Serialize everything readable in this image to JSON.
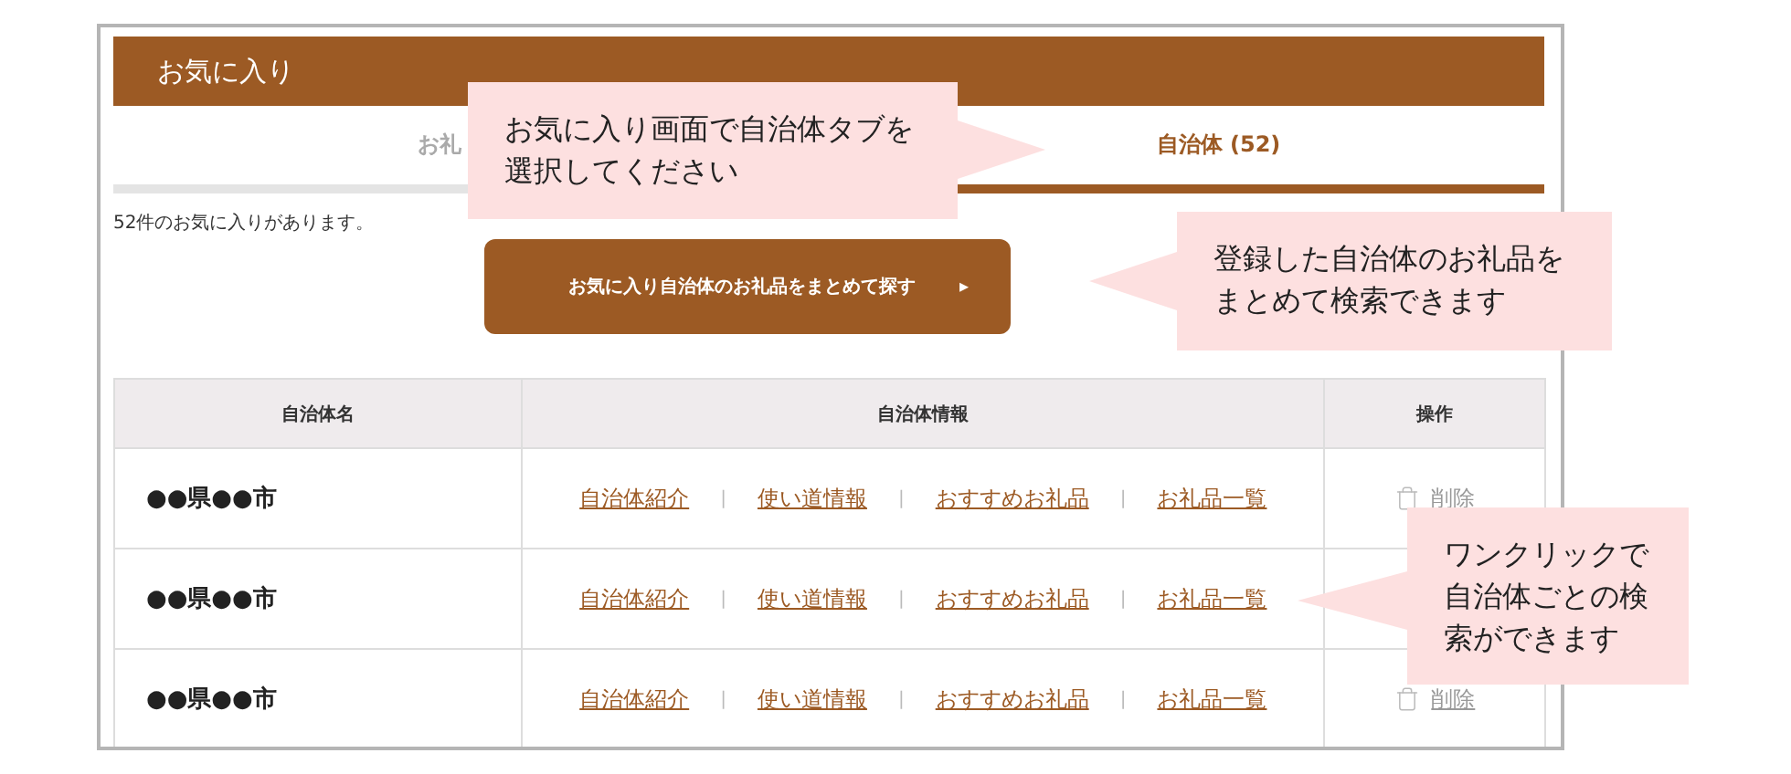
{
  "header": {
    "title": "お気に入り"
  },
  "tabs": [
    {
      "label": "お礼",
      "selected": false
    },
    {
      "label": "自治体 (52)",
      "selected": true
    }
  ],
  "count_text": "52件のお気に入りがあります。",
  "search_button": {
    "label": "お気に入り自治体のお礼品をまとめて探す",
    "arrow": "▸"
  },
  "table": {
    "columns": [
      "自治体名",
      "自治体情報",
      "操作"
    ],
    "rows": [
      {
        "name": "●●県●●市",
        "links": [
          {
            "kind": "link",
            "text": "自治体紹介"
          },
          {
            "kind": "separator",
            "text": "|"
          },
          {
            "kind": "link",
            "text": "使い道情報"
          },
          {
            "kind": "separator",
            "text": "|"
          },
          {
            "kind": "link",
            "text": "おすすめお礼品"
          },
          {
            "kind": "separator",
            "text": "|"
          },
          {
            "kind": "link",
            "text": "お礼品一覧"
          }
        ],
        "delete": "削除"
      },
      {
        "name": "●●県●●市",
        "links": [
          {
            "kind": "link",
            "text": "自治体紹介"
          },
          {
            "kind": "separator",
            "text": "|"
          },
          {
            "kind": "link",
            "text": "使い道情報"
          },
          {
            "kind": "separator",
            "text": "|"
          },
          {
            "kind": "link",
            "text": "おすすめお礼品"
          },
          {
            "kind": "separator",
            "text": "|"
          },
          {
            "kind": "link",
            "text": "お礼品一覧"
          }
        ]
      },
      {
        "name": "●●県●●市",
        "links": [
          {
            "kind": "link",
            "text": "自治体紹介"
          },
          {
            "kind": "separator",
            "text": "|"
          },
          {
            "kind": "link",
            "text": "使い道情報"
          },
          {
            "kind": "separator",
            "text": "|"
          },
          {
            "kind": "link",
            "text": "おすすめお礼品"
          },
          {
            "kind": "separator",
            "text": "|"
          },
          {
            "kind": "link",
            "text": "お礼品一覧"
          }
        ],
        "delete": "削除"
      }
    ]
  },
  "callouts": [
    {
      "text": "お気に入り画面で自治体タブを選択してください"
    },
    {
      "text": "登録した自治体のお礼品をまとめて検索できます"
    },
    {
      "text": "ワンクリックで自治体ごとの検索ができます"
    }
  ]
}
